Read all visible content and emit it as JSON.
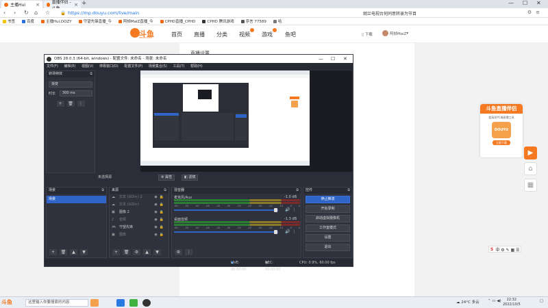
{
  "browser": {
    "tabs": [
      {
        "title": "主播Hui"
      },
      {
        "title": "直播伴侣 - 斗鱼"
      }
    ],
    "url": "https://mp.douyu.com/live/main",
    "address_right_text": "胡兰电视台何同意转录为节目",
    "bookmarks": [
      "书签",
      "百度",
      "主播Hui,DOZY",
      "守望先锋直播_今",
      "阿帧MaiZ直播_今",
      "CPHD直播_CPHD",
      "CPHD 腾讯游戏",
      "序言 77589",
      "哈"
    ]
  },
  "site": {
    "logo_text": "斗鱼",
    "logo_sub": "douyu.com",
    "nav": [
      "首页",
      "直播",
      "分类",
      "视频",
      "游戏",
      "鱼吧"
    ],
    "download_label": "下载",
    "username": "阿帧MaiZ",
    "page_heading": "直播设置"
  },
  "promo": {
    "title": "斗鱼直播伴侣",
    "desc": "超高质PC端直播工具",
    "image_text": "DOUYU",
    "button": "立即下载"
  },
  "obs": {
    "title": "OBS 28.0.3 (64-bit, windows) - 配置文件: 未命名 - 场景: 未命名",
    "menu": [
      "文件(F)",
      "编辑(E)",
      "视图(V)",
      "停靠窗口(D)",
      "配置文件(P)",
      "场景集合(S)",
      "工具(T)",
      "帮助(H)"
    ],
    "transition": {
      "header": "转场特效",
      "type": "渐变",
      "duration_label": "时长",
      "duration_value": "300 ms"
    },
    "no_source": "未选择源",
    "props_button": "属性",
    "filters_button": "滤镜",
    "scenes": {
      "header": "场景",
      "items": [
        "场景"
      ]
    },
    "sources": {
      "header": "来源",
      "items": [
        "文本 (GDI+) 2",
        "文本 (GDI+)",
        "图像 2",
        "音频",
        "守望先锋",
        "图像"
      ]
    },
    "mixer": {
      "header": "混音器",
      "tracks": [
        {
          "name": "麦克风/Aux",
          "db": "-1.0 dB"
        },
        {
          "name": "桌面音频",
          "db": "-1.3 dB"
        }
      ],
      "scale": [
        "-60",
        "-55",
        "-50",
        "-45",
        "-40",
        "-35",
        "-30",
        "-25",
        "-20",
        "-15",
        "-10",
        "-5",
        "0"
      ]
    },
    "controls": {
      "header": "控件",
      "buttons": [
        "停止推流",
        "开始录制",
        "启动虚拟摄像机",
        "工作室模式",
        "设置",
        "退出"
      ]
    },
    "status": {
      "live": "LIVE: 00:00:00",
      "rec": "REC: 00:00:00",
      "cpu": "CPU: 0.9%, 60.00 fps"
    }
  },
  "taskbar": {
    "search_placeholder": "这里输入你要搜索的内容",
    "weather": "24°C 多云",
    "time": "22:32",
    "date": "2022/10/5"
  },
  "colors": {
    "brand": "#f47920",
    "obs_bg": "#2b2e38",
    "obs_accent": "#2f65c6"
  }
}
